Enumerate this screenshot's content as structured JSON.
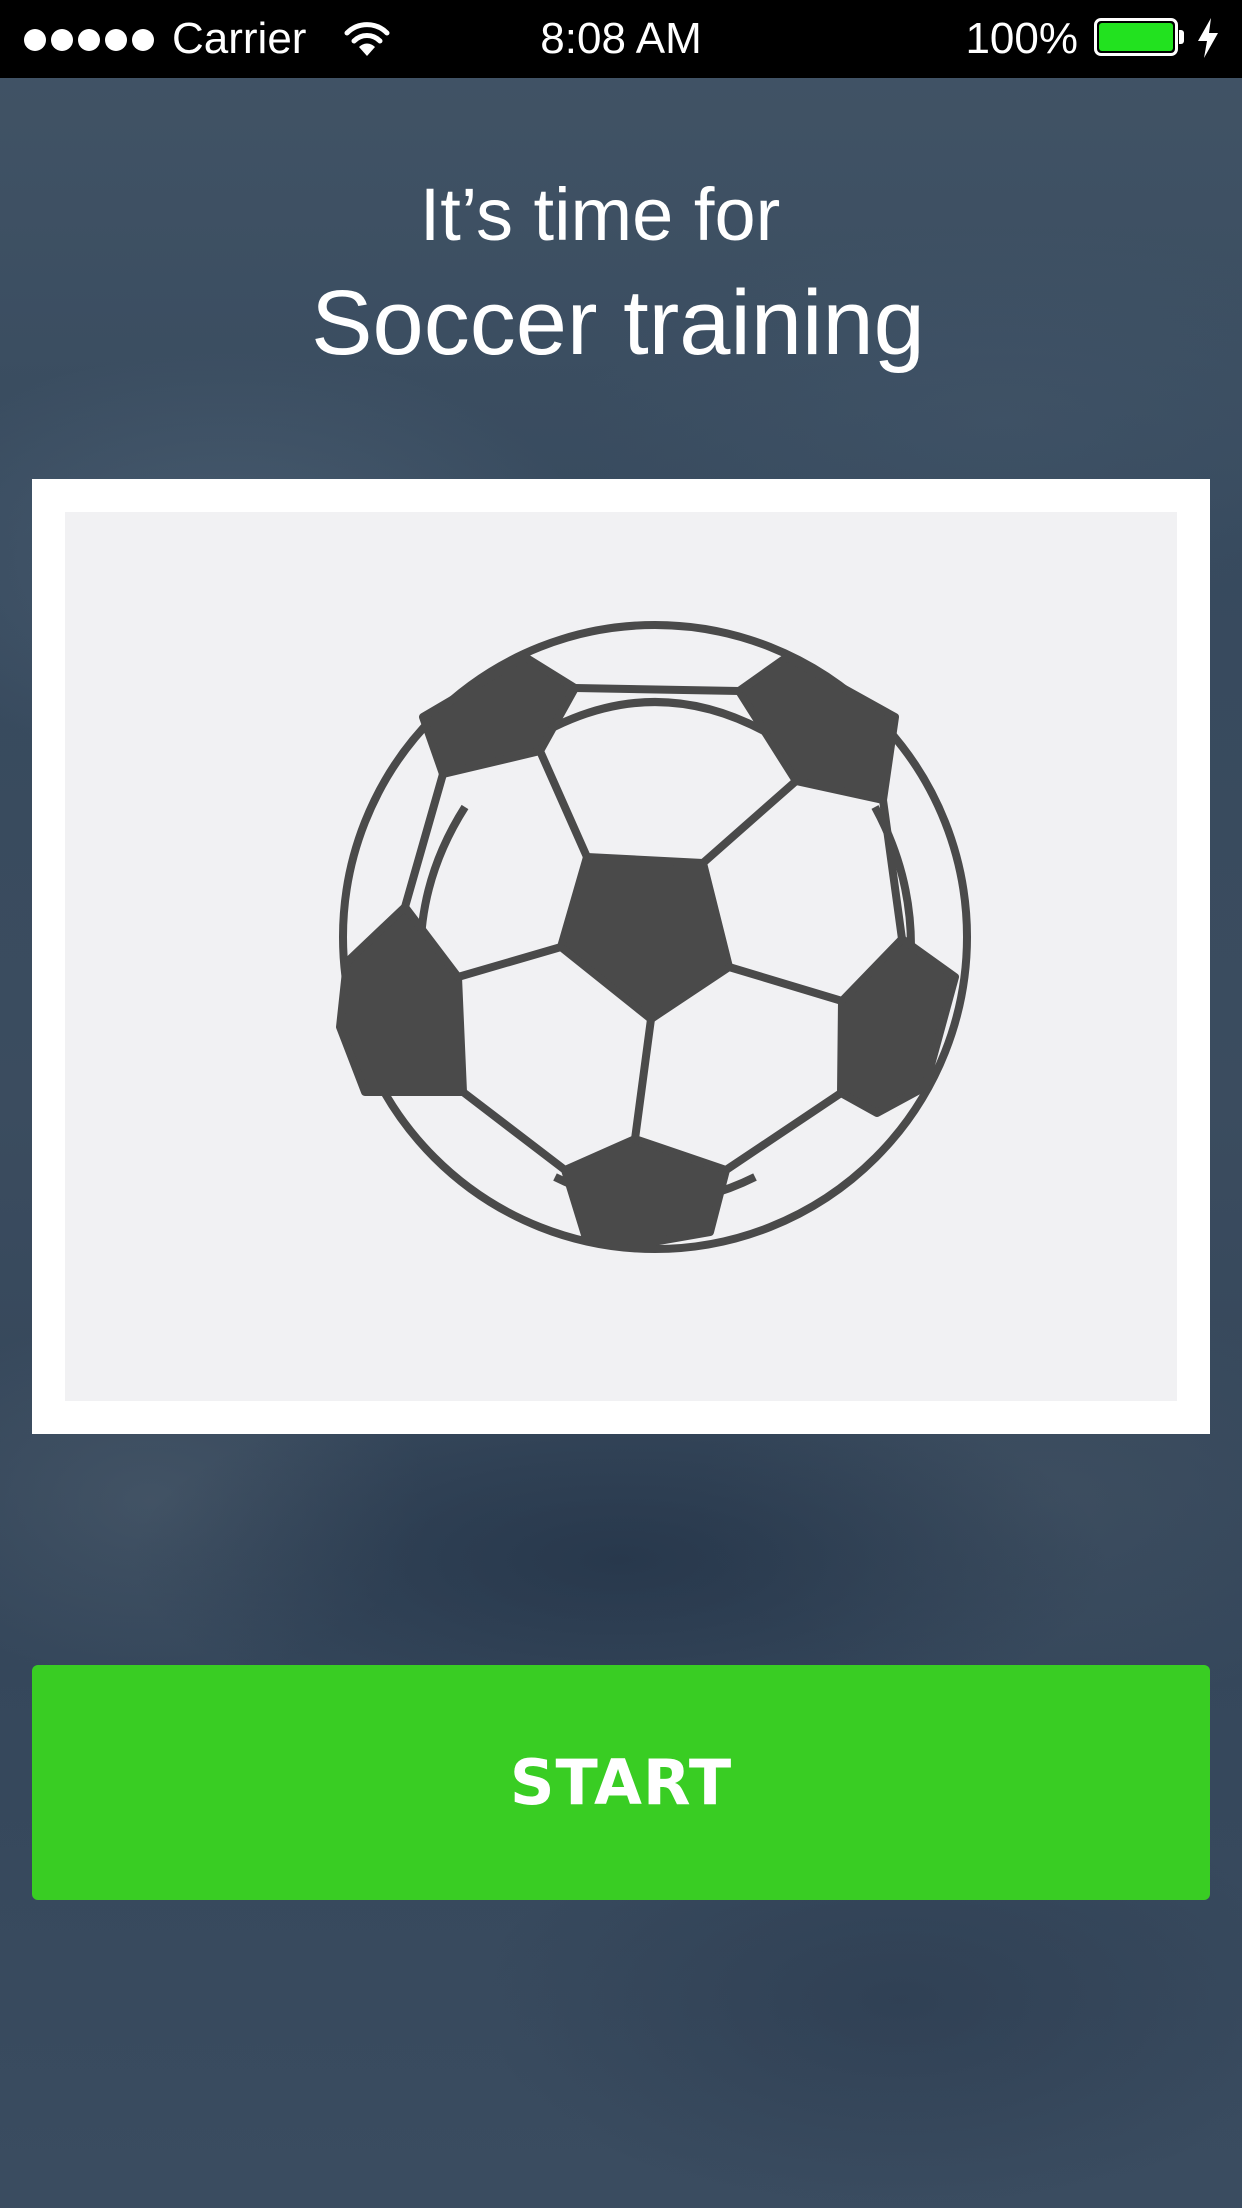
{
  "status_bar": {
    "carrier": "Carrier",
    "time": "8:08 AM",
    "battery_percent": "100%",
    "battery_level": 1.0,
    "battery_color": "#22e21f",
    "icons": [
      "signal-dots-icon",
      "wifi-icon",
      "battery-icon",
      "charging-bolt-icon"
    ]
  },
  "heading": {
    "subtitle": "It’s time for",
    "title": "Soccer training"
  },
  "training_image": {
    "icon": "soccer-ball-icon"
  },
  "start_button": {
    "label": "START",
    "color": "#39cd23"
  }
}
